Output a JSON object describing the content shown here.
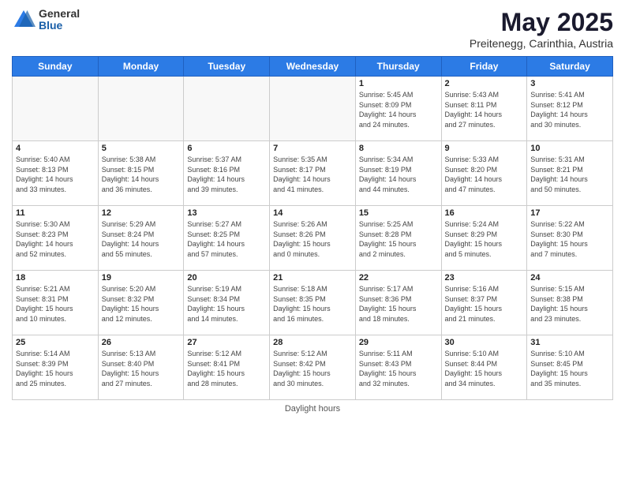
{
  "logo": {
    "general": "General",
    "blue": "Blue"
  },
  "title": "May 2025",
  "location": "Preitenegg, Carinthia, Austria",
  "days_of_week": [
    "Sunday",
    "Monday",
    "Tuesday",
    "Wednesday",
    "Thursday",
    "Friday",
    "Saturday"
  ],
  "footer": "Daylight hours",
  "weeks": [
    [
      {
        "day": "",
        "info": ""
      },
      {
        "day": "",
        "info": ""
      },
      {
        "day": "",
        "info": ""
      },
      {
        "day": "",
        "info": ""
      },
      {
        "day": "1",
        "info": "Sunrise: 5:45 AM\nSunset: 8:09 PM\nDaylight: 14 hours\nand 24 minutes."
      },
      {
        "day": "2",
        "info": "Sunrise: 5:43 AM\nSunset: 8:11 PM\nDaylight: 14 hours\nand 27 minutes."
      },
      {
        "day": "3",
        "info": "Sunrise: 5:41 AM\nSunset: 8:12 PM\nDaylight: 14 hours\nand 30 minutes."
      }
    ],
    [
      {
        "day": "4",
        "info": "Sunrise: 5:40 AM\nSunset: 8:13 PM\nDaylight: 14 hours\nand 33 minutes."
      },
      {
        "day": "5",
        "info": "Sunrise: 5:38 AM\nSunset: 8:15 PM\nDaylight: 14 hours\nand 36 minutes."
      },
      {
        "day": "6",
        "info": "Sunrise: 5:37 AM\nSunset: 8:16 PM\nDaylight: 14 hours\nand 39 minutes."
      },
      {
        "day": "7",
        "info": "Sunrise: 5:35 AM\nSunset: 8:17 PM\nDaylight: 14 hours\nand 41 minutes."
      },
      {
        "day": "8",
        "info": "Sunrise: 5:34 AM\nSunset: 8:19 PM\nDaylight: 14 hours\nand 44 minutes."
      },
      {
        "day": "9",
        "info": "Sunrise: 5:33 AM\nSunset: 8:20 PM\nDaylight: 14 hours\nand 47 minutes."
      },
      {
        "day": "10",
        "info": "Sunrise: 5:31 AM\nSunset: 8:21 PM\nDaylight: 14 hours\nand 50 minutes."
      }
    ],
    [
      {
        "day": "11",
        "info": "Sunrise: 5:30 AM\nSunset: 8:23 PM\nDaylight: 14 hours\nand 52 minutes."
      },
      {
        "day": "12",
        "info": "Sunrise: 5:29 AM\nSunset: 8:24 PM\nDaylight: 14 hours\nand 55 minutes."
      },
      {
        "day": "13",
        "info": "Sunrise: 5:27 AM\nSunset: 8:25 PM\nDaylight: 14 hours\nand 57 minutes."
      },
      {
        "day": "14",
        "info": "Sunrise: 5:26 AM\nSunset: 8:26 PM\nDaylight: 15 hours\nand 0 minutes."
      },
      {
        "day": "15",
        "info": "Sunrise: 5:25 AM\nSunset: 8:28 PM\nDaylight: 15 hours\nand 2 minutes."
      },
      {
        "day": "16",
        "info": "Sunrise: 5:24 AM\nSunset: 8:29 PM\nDaylight: 15 hours\nand 5 minutes."
      },
      {
        "day": "17",
        "info": "Sunrise: 5:22 AM\nSunset: 8:30 PM\nDaylight: 15 hours\nand 7 minutes."
      }
    ],
    [
      {
        "day": "18",
        "info": "Sunrise: 5:21 AM\nSunset: 8:31 PM\nDaylight: 15 hours\nand 10 minutes."
      },
      {
        "day": "19",
        "info": "Sunrise: 5:20 AM\nSunset: 8:32 PM\nDaylight: 15 hours\nand 12 minutes."
      },
      {
        "day": "20",
        "info": "Sunrise: 5:19 AM\nSunset: 8:34 PM\nDaylight: 15 hours\nand 14 minutes."
      },
      {
        "day": "21",
        "info": "Sunrise: 5:18 AM\nSunset: 8:35 PM\nDaylight: 15 hours\nand 16 minutes."
      },
      {
        "day": "22",
        "info": "Sunrise: 5:17 AM\nSunset: 8:36 PM\nDaylight: 15 hours\nand 18 minutes."
      },
      {
        "day": "23",
        "info": "Sunrise: 5:16 AM\nSunset: 8:37 PM\nDaylight: 15 hours\nand 21 minutes."
      },
      {
        "day": "24",
        "info": "Sunrise: 5:15 AM\nSunset: 8:38 PM\nDaylight: 15 hours\nand 23 minutes."
      }
    ],
    [
      {
        "day": "25",
        "info": "Sunrise: 5:14 AM\nSunset: 8:39 PM\nDaylight: 15 hours\nand 25 minutes."
      },
      {
        "day": "26",
        "info": "Sunrise: 5:13 AM\nSunset: 8:40 PM\nDaylight: 15 hours\nand 27 minutes."
      },
      {
        "day": "27",
        "info": "Sunrise: 5:12 AM\nSunset: 8:41 PM\nDaylight: 15 hours\nand 28 minutes."
      },
      {
        "day": "28",
        "info": "Sunrise: 5:12 AM\nSunset: 8:42 PM\nDaylight: 15 hours\nand 30 minutes."
      },
      {
        "day": "29",
        "info": "Sunrise: 5:11 AM\nSunset: 8:43 PM\nDaylight: 15 hours\nand 32 minutes."
      },
      {
        "day": "30",
        "info": "Sunrise: 5:10 AM\nSunset: 8:44 PM\nDaylight: 15 hours\nand 34 minutes."
      },
      {
        "day": "31",
        "info": "Sunrise: 5:10 AM\nSunset: 8:45 PM\nDaylight: 15 hours\nand 35 minutes."
      }
    ]
  ]
}
